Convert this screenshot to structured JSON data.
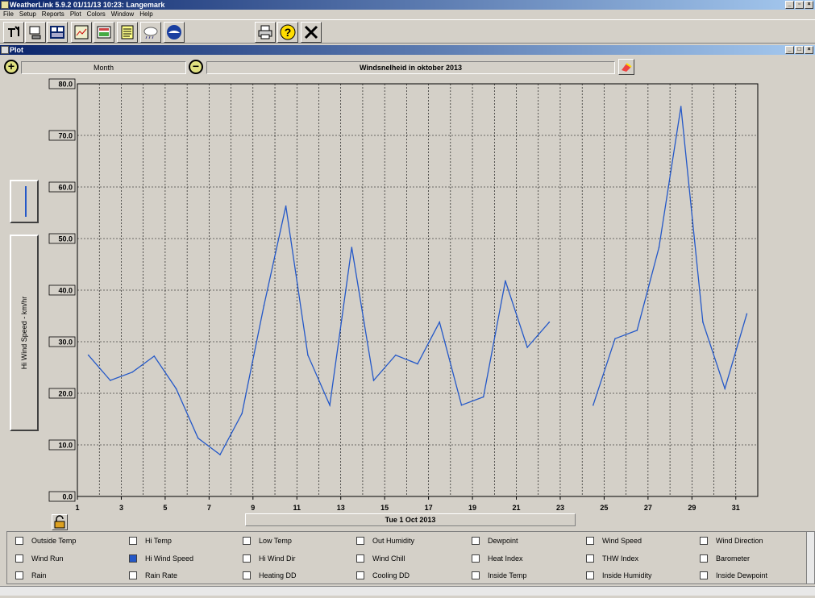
{
  "app": {
    "title": "WeatherLink 5.9.2  01/11/13  10:23: Langemark"
  },
  "menu": [
    "File",
    "Setup",
    "Reports",
    "Plot",
    "Colors",
    "Window",
    "Help"
  ],
  "plot_window": {
    "title": "Plot",
    "span_label": "Month",
    "graph_title": "Windsnelheid in oktober 2013",
    "ylabel": "Hi Wind Speed - km/hr",
    "date_label": "Tue 1 Oct 2013"
  },
  "chart_data": {
    "type": "line",
    "title": "Windsnelheid in oktober 2013",
    "ylabel": "Hi Wind Speed - km/hr",
    "xlabel": "Tue 1 Oct 2013",
    "ylim": [
      0,
      80
    ],
    "xlim": [
      1,
      32
    ],
    "grid": true,
    "y_ticks": [
      "0.0",
      "10.0",
      "20.0",
      "30.0",
      "40.0",
      "50.0",
      "60.0",
      "70.0",
      "80.0"
    ],
    "x_ticks": [
      "1",
      "3",
      "5",
      "7",
      "9",
      "11",
      "13",
      "15",
      "17",
      "19",
      "21",
      "23",
      "25",
      "27",
      "29",
      "31"
    ],
    "series": [
      {
        "color": "#2458c8",
        "x": [
          1.5,
          2.5,
          3.5,
          4.5,
          5.5,
          6.5,
          7.5,
          8.5,
          9.5,
          10.5,
          11.5,
          12.5,
          13.5,
          14.5,
          15.5,
          16.5,
          17.5,
          18.5,
          19.5,
          20.5,
          21.5,
          22.5,
          23.5,
          24.5,
          25.5,
          26.5,
          27.5,
          28.5,
          29.5,
          30.5,
          31.5
        ],
        "values": [
          27.4,
          22.5,
          24.1,
          27.2,
          20.9,
          11.3,
          8.1,
          16.1,
          37.0,
          56.3,
          27.4,
          17.7,
          48.3,
          22.5,
          27.4,
          25.7,
          33.8,
          17.7,
          19.3,
          41.8,
          28.9,
          33.8,
          null,
          17.7,
          30.6,
          32.2,
          48.3,
          75.6,
          33.8,
          20.9,
          35.4
        ]
      }
    ]
  },
  "checkboxes": [
    {
      "label": "Outside Temp",
      "checked": false
    },
    {
      "label": "Hi Temp",
      "checked": false
    },
    {
      "label": "Low Temp",
      "checked": false
    },
    {
      "label": "Out Humidity",
      "checked": false
    },
    {
      "label": "Dewpoint",
      "checked": false
    },
    {
      "label": "Wind Speed",
      "checked": false
    },
    {
      "label": "Wind Direction",
      "checked": false
    },
    {
      "label": "Wind Run",
      "checked": false
    },
    {
      "label": "Hi Wind Speed",
      "checked": true
    },
    {
      "label": "Hi Wind Dir",
      "checked": false
    },
    {
      "label": "Wind Chill",
      "checked": false
    },
    {
      "label": "Heat Index",
      "checked": false
    },
    {
      "label": "THW Index",
      "checked": false
    },
    {
      "label": "Barometer",
      "checked": false
    },
    {
      "label": "Rain",
      "checked": false
    },
    {
      "label": "Rain Rate",
      "checked": false
    },
    {
      "label": "Heating DD",
      "checked": false
    },
    {
      "label": "Cooling DD",
      "checked": false
    },
    {
      "label": "Inside Temp",
      "checked": false
    },
    {
      "label": "Inside Humidity",
      "checked": false
    },
    {
      "label": "Inside Dewpoint",
      "checked": false
    }
  ]
}
